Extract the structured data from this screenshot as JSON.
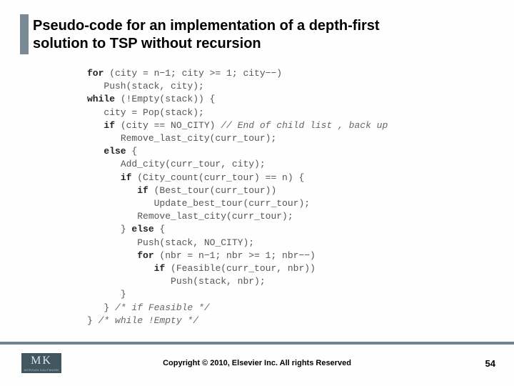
{
  "title": {
    "line1": "Pseudo-code for an implementation of a depth-first",
    "line2": "solution to TSP  without recursion"
  },
  "code_lines": [
    {
      "indent": 0,
      "segs": [
        {
          "t": "for",
          "c": "kw"
        },
        {
          "t": " (city = n−1; city >= 1; city−−)"
        }
      ]
    },
    {
      "indent": 1,
      "segs": [
        {
          "t": "Push(stack, city);"
        }
      ]
    },
    {
      "indent": 0,
      "segs": [
        {
          "t": "while",
          "c": "kw"
        },
        {
          "t": " (!Empty(stack)) {"
        }
      ]
    },
    {
      "indent": 1,
      "segs": [
        {
          "t": "city = Pop(stack);"
        }
      ]
    },
    {
      "indent": 1,
      "segs": [
        {
          "t": "if",
          "c": "kw"
        },
        {
          "t": " (city == NO_CITY) "
        },
        {
          "t": "// End of child list , back up",
          "c": "cm"
        }
      ]
    },
    {
      "indent": 2,
      "segs": [
        {
          "t": "Remove_last_city(curr_tour);"
        }
      ]
    },
    {
      "indent": 1,
      "segs": [
        {
          "t": "else",
          "c": "kw"
        },
        {
          "t": " {"
        }
      ]
    },
    {
      "indent": 2,
      "segs": [
        {
          "t": "Add_city(curr_tour, city);"
        }
      ]
    },
    {
      "indent": 2,
      "segs": [
        {
          "t": "if",
          "c": "kw"
        },
        {
          "t": " (City_count(curr_tour) == n) {"
        }
      ]
    },
    {
      "indent": 3,
      "segs": [
        {
          "t": "if",
          "c": "kw"
        },
        {
          "t": " (Best_tour(curr_tour))"
        }
      ]
    },
    {
      "indent": 4,
      "segs": [
        {
          "t": "Update_best_tour(curr_tour);"
        }
      ]
    },
    {
      "indent": 3,
      "segs": [
        {
          "t": "Remove_last_city(curr_tour);"
        }
      ]
    },
    {
      "indent": 2,
      "segs": [
        {
          "t": "} "
        },
        {
          "t": "else",
          "c": "kw"
        },
        {
          "t": " {"
        }
      ]
    },
    {
      "indent": 3,
      "segs": [
        {
          "t": "Push(stack, NO_CITY);"
        }
      ]
    },
    {
      "indent": 3,
      "segs": [
        {
          "t": "for",
          "c": "kw"
        },
        {
          "t": " (nbr = n−1; nbr >= 1; nbr−−)"
        }
      ]
    },
    {
      "indent": 4,
      "segs": [
        {
          "t": "if",
          "c": "kw"
        },
        {
          "t": " (Feasible(curr_tour, nbr))"
        }
      ]
    },
    {
      "indent": 5,
      "segs": [
        {
          "t": "Push(stack, nbr);"
        }
      ]
    },
    {
      "indent": 2,
      "segs": [
        {
          "t": "}"
        }
      ]
    },
    {
      "indent": 1,
      "segs": [
        {
          "t": "} "
        },
        {
          "t": "/* if Feasible */",
          "c": "cm"
        }
      ]
    },
    {
      "indent": 0,
      "segs": [
        {
          "t": "} "
        },
        {
          "t": "/* while !Empty */",
          "c": "cm"
        }
      ]
    }
  ],
  "footer": {
    "logo_main": "MK",
    "logo_sub": "MORGAN KAUFMANN",
    "copyright": "Copyright © 2010, Elsevier Inc. All rights Reserved",
    "page_number": "54"
  }
}
